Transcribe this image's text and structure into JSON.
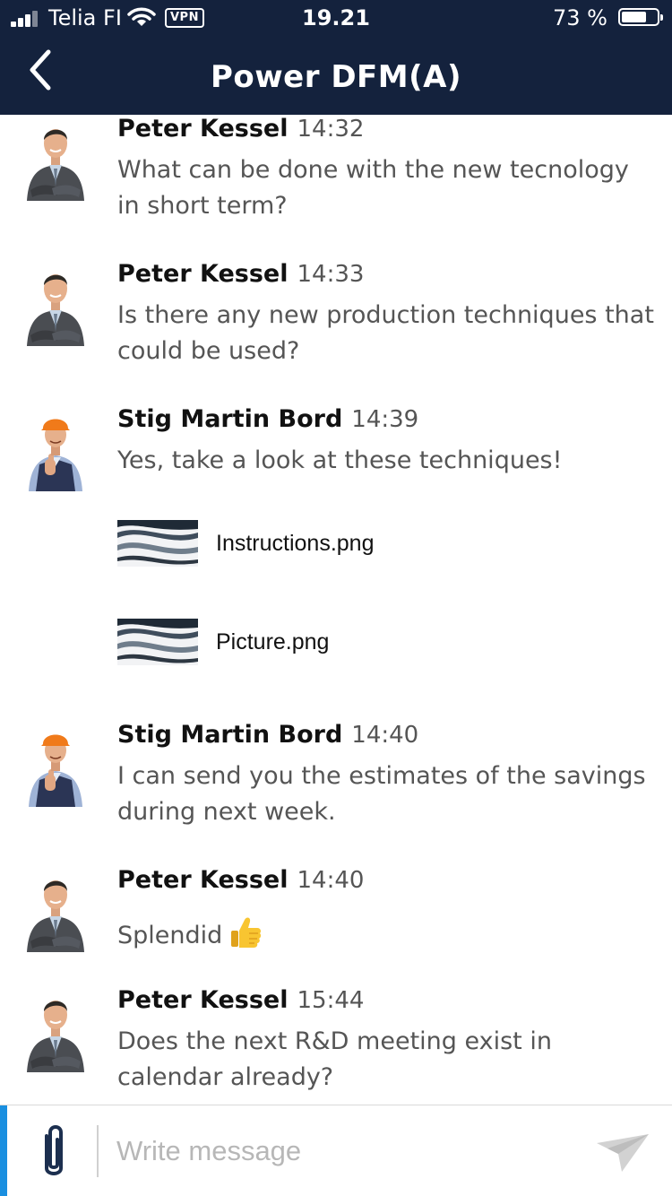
{
  "status_bar": {
    "carrier": "Telia FI",
    "vpn": "VPN",
    "time": "19.21",
    "battery": "73 %",
    "battery_level": 0.73
  },
  "header": {
    "title": "Power DFM(A)",
    "back_icon": "chevron-left-icon"
  },
  "messages": [
    {
      "sender": "Peter Kessel",
      "time": "14:32",
      "text": "What can be done with the new tecnology in short term?"
    },
    {
      "sender": "Peter Kessel",
      "time": "14:33",
      "text": "Is there any new production techniques that could be used?"
    },
    {
      "sender": "Stig Martin Bord",
      "time": "14:39",
      "text": "Yes, take a look at these techniques!",
      "attachments": [
        {
          "name": "Instructions.png",
          "icon": "image-thumbnail-icon"
        },
        {
          "name": "Picture.png",
          "icon": "image-thumbnail-icon"
        }
      ]
    },
    {
      "sender": "Stig Martin Bord",
      "time": "14:40",
      "text": "I can send you the estimates of the savings during next week."
    },
    {
      "sender": "Peter Kessel",
      "time": "14:40",
      "text": "Splendid",
      "emoji": "thumbs-up-icon"
    },
    {
      "sender": "Peter Kessel",
      "time": "15:44",
      "text": "Does the next R&D meeting exist in calendar already?"
    }
  ],
  "composer": {
    "placeholder": "Write message",
    "value": "",
    "attach_icon": "paperclip-icon",
    "send_icon": "send-icon"
  },
  "colors": {
    "header_bg": "#14223d",
    "accent": "#1a8fe0",
    "sender_text": "#111111",
    "body_text": "#555555",
    "placeholder": "#b7b7b7"
  }
}
